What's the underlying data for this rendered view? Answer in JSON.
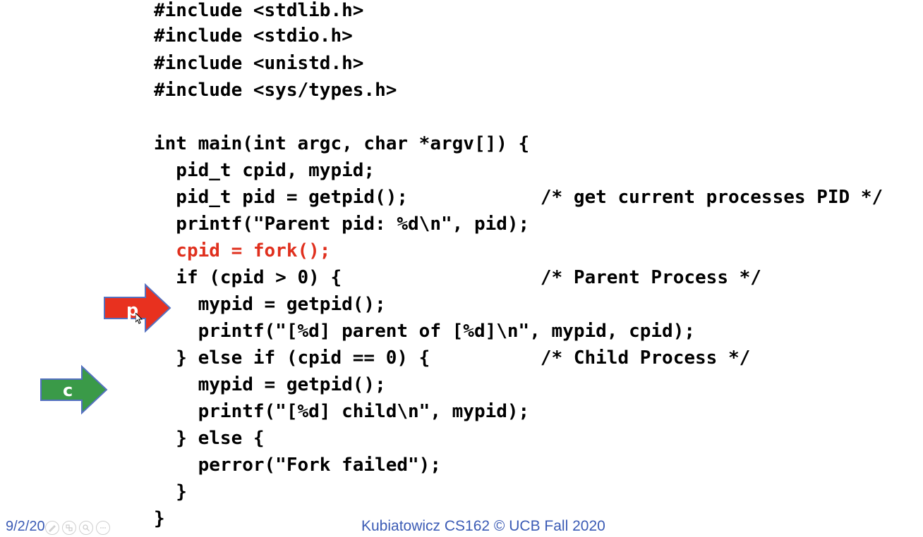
{
  "code": {
    "lines": [
      "#include <stdlib.h>",
      "#include <stdio.h>",
      "#include <unistd.h>",
      "#include <sys/types.h>",
      "",
      "int main(int argc, char *argv[]) {",
      "  pid_t cpid, mypid;",
      "  pid_t pid = getpid();            /* get current processes PID */",
      "  printf(\"Parent pid: %d\\n\", pid);",
      "  cpid = fork();",
      "  if (cpid > 0) {                  /* Parent Process */",
      "    mypid = getpid();",
      "    printf(\"[%d] parent of [%d]\\n\", mypid, cpid);",
      "  } else if (cpid == 0) {          /* Child Process */",
      "    mypid = getpid();",
      "    printf(\"[%d] child\\n\", mypid);",
      "  } else {",
      "    perror(\"Fork failed\");",
      "  }",
      "}"
    ],
    "highlight_color": "#e0301e",
    "text_color": "#000000"
  },
  "arrows": {
    "parent": {
      "label": "p",
      "color": "#e8311f",
      "border": "#5470c0"
    },
    "child": {
      "label": "c",
      "color": "#3a9a48",
      "border": "#5470c0"
    }
  },
  "footer": {
    "date": "9/2/20",
    "credit": "Kubiatowicz CS162 © UCB Fall 2020",
    "text_color": "#3b5bb5"
  },
  "controls": {
    "icons": [
      "pen-icon",
      "slides-icon",
      "zoom-icon",
      "more-icon"
    ]
  }
}
